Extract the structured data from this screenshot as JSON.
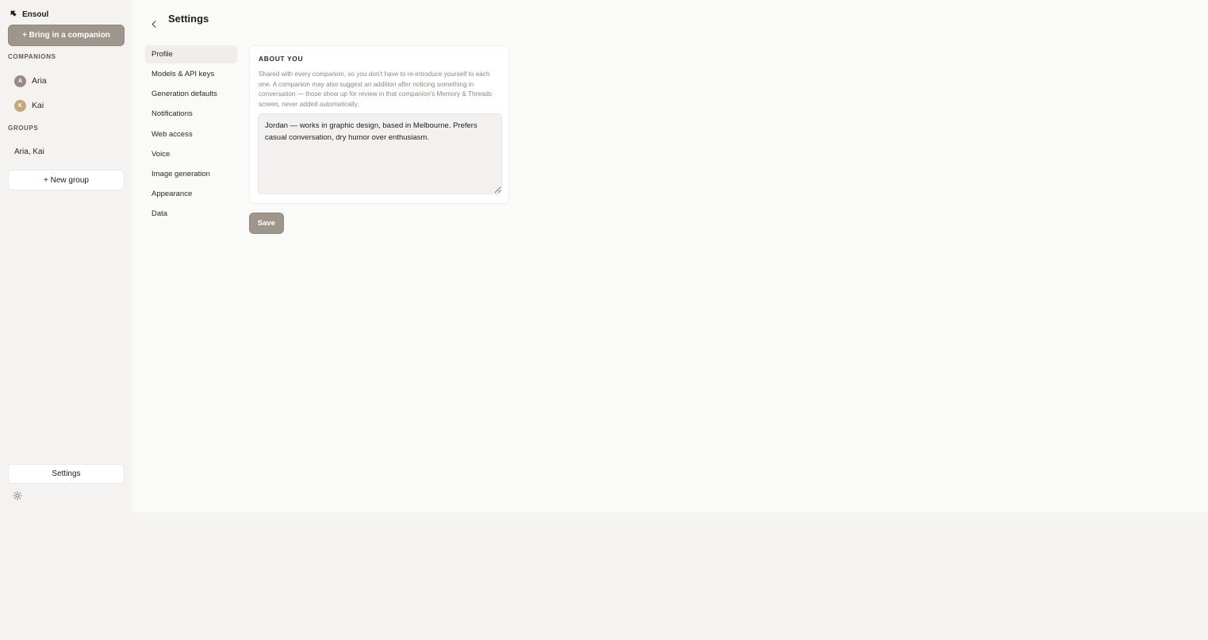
{
  "sidebar": {
    "brand": "Ensoul",
    "bring_button": "+ Bring in a companion",
    "companions_label": "COMPANIONS",
    "companions": [
      {
        "initial": "A",
        "name": "Aria",
        "color": "#9b8985"
      },
      {
        "initial": "K",
        "name": "Kai",
        "color": "#c3a67a"
      }
    ],
    "groups_label": "GROUPS",
    "groups": [
      {
        "name": "Aria, Kai"
      }
    ],
    "new_group_button": "+ New group",
    "settings_button": "Settings",
    "theme_icon": "sun-icon"
  },
  "header": {
    "back_icon": "chevron-left-icon",
    "title": "Settings"
  },
  "settings_nav": [
    {
      "label": "Profile",
      "active": true
    },
    {
      "label": "Models & API keys",
      "active": false
    },
    {
      "label": "Generation defaults",
      "active": false
    },
    {
      "label": "Notifications",
      "active": false
    },
    {
      "label": "Web access",
      "active": false
    },
    {
      "label": "Voice",
      "active": false
    },
    {
      "label": "Image generation",
      "active": false
    },
    {
      "label": "Appearance",
      "active": false
    },
    {
      "label": "Data",
      "active": false
    }
  ],
  "profile": {
    "section_title": "ABOUT YOU",
    "description": "Shared with every companion, so you don't have to re-introduce yourself to each one. A companion may also suggest an addition after noticing something in conversation — those show up for review in that companion's Memory & Threads screen, never added automatically.",
    "about_value": "Jordan — works in graphic design, based in Melbourne. Prefers casual conversation, dry humor over enthusiasm.",
    "save_button": "Save"
  },
  "colors": {
    "accent": "#9e958c",
    "sidebar_bg": "#f4f3f1",
    "page_bg": "#fafaf9"
  }
}
